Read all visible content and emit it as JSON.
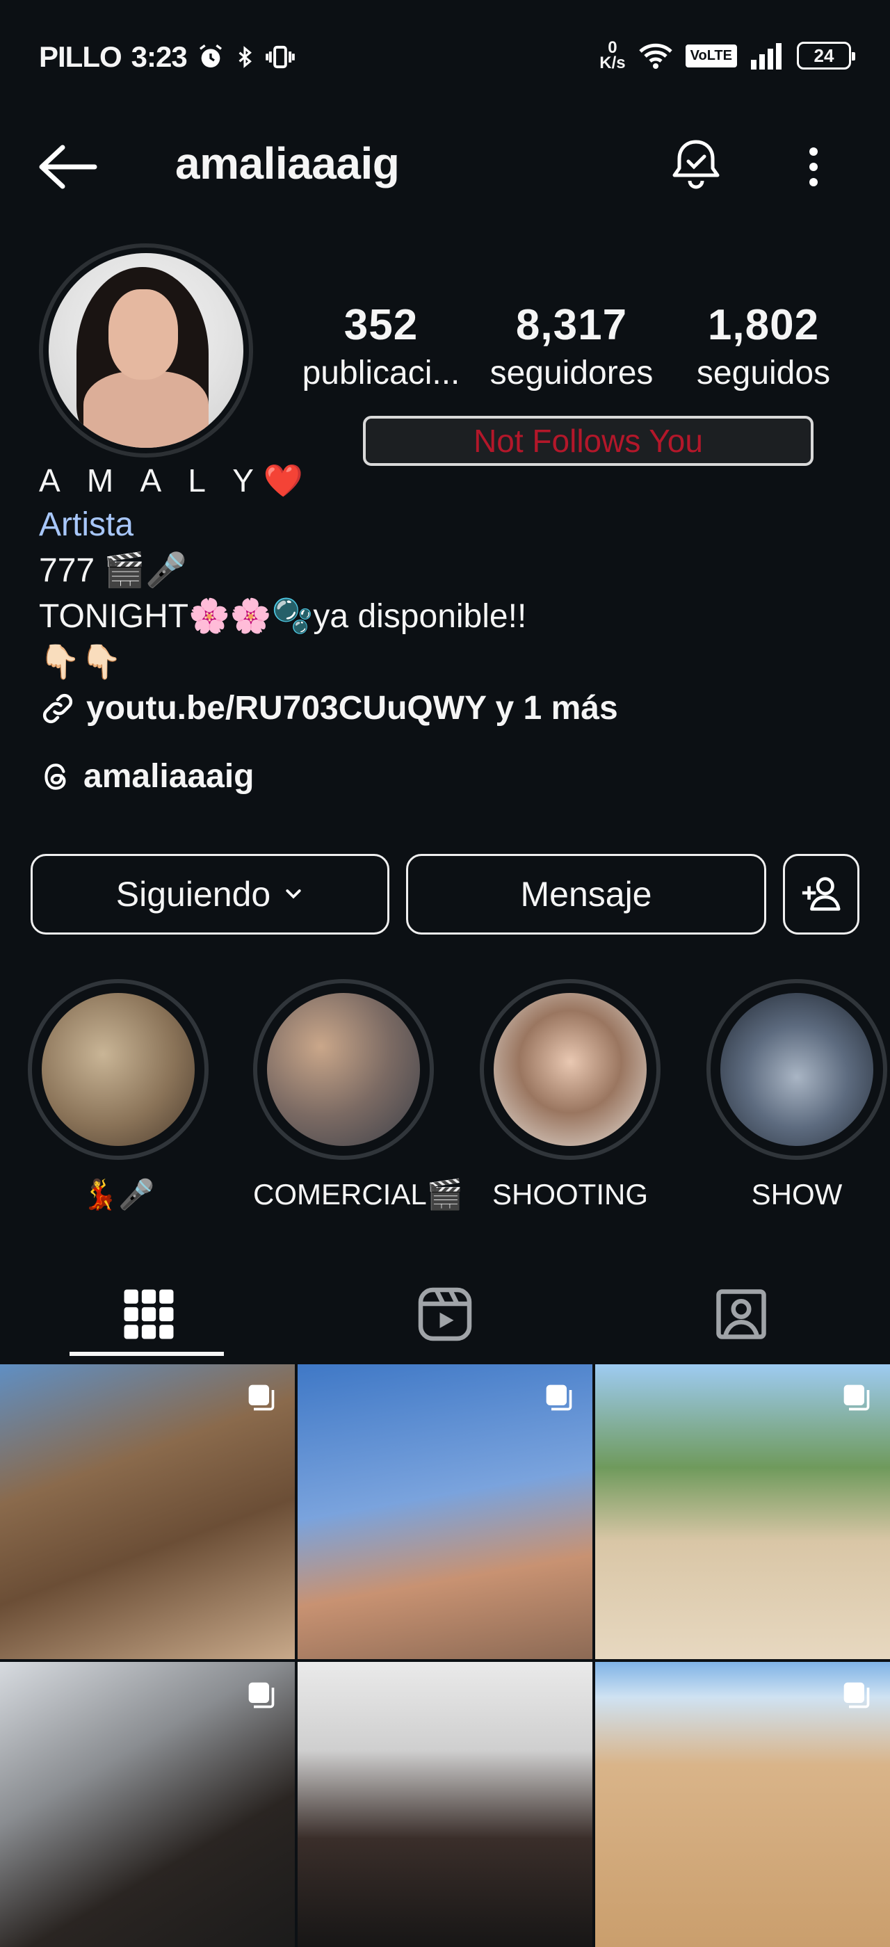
{
  "status_bar": {
    "carrier": "PILLO",
    "time": "3:23",
    "speed_value": "0",
    "speed_unit": "K/s",
    "network_badge": "VoLTE",
    "battery": "24"
  },
  "header": {
    "username": "amaliaaaig"
  },
  "profile": {
    "stats": [
      {
        "value": "352",
        "label": "publicaci..."
      },
      {
        "value": "8,317",
        "label": "seguidores"
      },
      {
        "value": "1,802",
        "label": "seguidos"
      }
    ],
    "follow_status": "Not Follows You",
    "display_name": "A M A L Y❤️",
    "category": "Artista",
    "bio_lines": [
      "777 🎬🎤",
      "TONIGHT🌸🌸🫧ya disponible!!",
      "👇🏻👇🏻"
    ],
    "link": "youtu.be/RU703CUuQWY y 1 más",
    "threads_handle": "amaliaaaig"
  },
  "actions": {
    "following_label": "Siguiendo",
    "message_label": "Mensaje"
  },
  "highlights": [
    {
      "label": "💃🎤",
      "colors": [
        "#c7b08f",
        "#6b5a4a"
      ]
    },
    {
      "label": "COMERCIAL🎬",
      "colors": [
        "#b89a83",
        "#3b3f48"
      ]
    },
    {
      "label": "SHOOTING",
      "colors": [
        "#e8e2dc",
        "#8a6a56"
      ]
    },
    {
      "label": "SHOW",
      "colors": [
        "#6e7f95",
        "#2b3340"
      ]
    }
  ],
  "tabs": [
    {
      "name": "grid",
      "active": true
    },
    {
      "name": "reels",
      "active": false
    },
    {
      "name": "tagged",
      "active": false
    }
  ],
  "posts": [
    {
      "colors": [
        "#6aa6dc",
        "#8a6a4c",
        "#c8a98a"
      ],
      "multi": true
    },
    {
      "colors": [
        "#3f78c6",
        "#7aa3dd",
        "#c89272"
      ],
      "multi": true
    },
    {
      "colors": [
        "#9ecbf2",
        "#d9c6a6",
        "#e7d8c0"
      ],
      "multi": true
    },
    {
      "colors": [
        "#d7dbe0",
        "#6d6f72",
        "#1a1a1a"
      ],
      "multi": true
    },
    {
      "colors": [
        "#eaeaea",
        "#cfcfcf",
        "#141414"
      ],
      "multi": false
    },
    {
      "colors": [
        "#7fb3e6",
        "#d9b489",
        "#c99d6b"
      ],
      "multi": true
    }
  ]
}
